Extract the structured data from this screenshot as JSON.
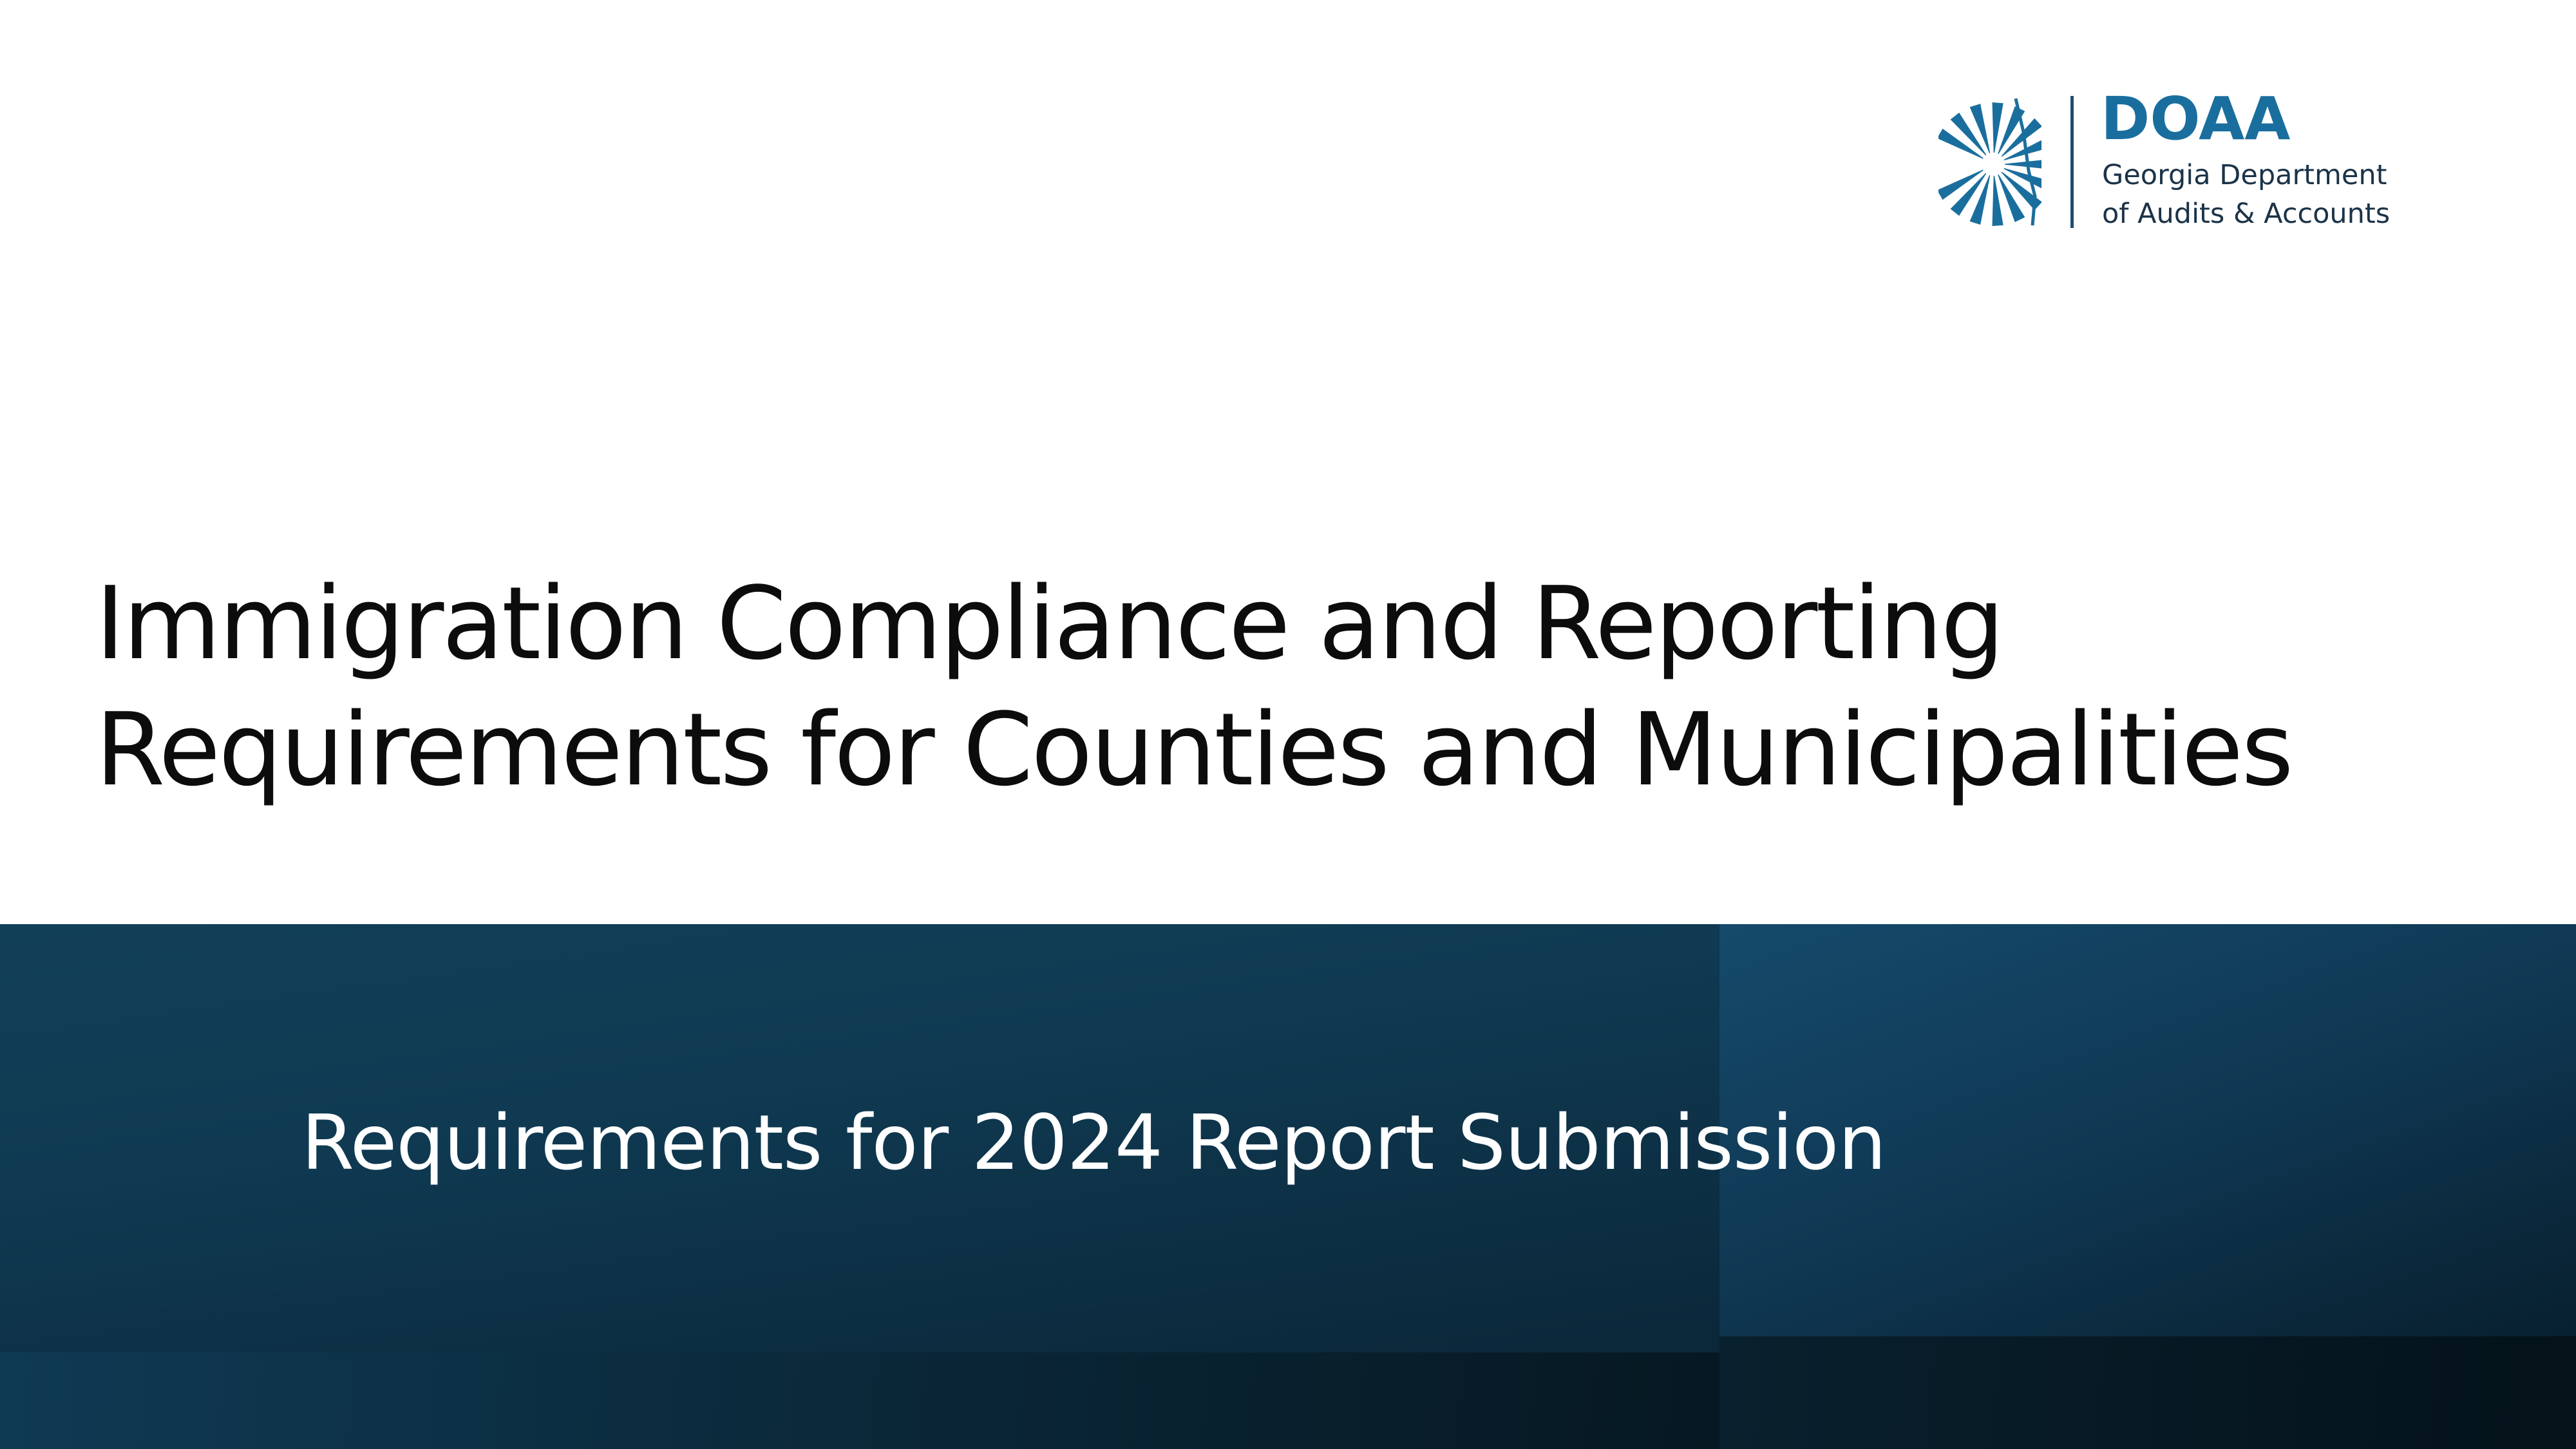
{
  "logo": {
    "abbreviation": "DOAA",
    "line1": "Georgia Department",
    "line2": "of Audits & Accounts",
    "icon": "georgia-state-sunburst-icon",
    "brand_color": "#1a6e9e"
  },
  "slide": {
    "title_line1": "Immigration Compliance and Reporting",
    "title_line2": "Requirements for Counties and Municipalities",
    "subtitle": "Requirements for 2024 Report Submission"
  },
  "colors": {
    "background": "#ffffff",
    "title_text": "#0c0c0c",
    "band_dark_blue": "#0f3a52",
    "subtitle_text": "#ffffff"
  }
}
